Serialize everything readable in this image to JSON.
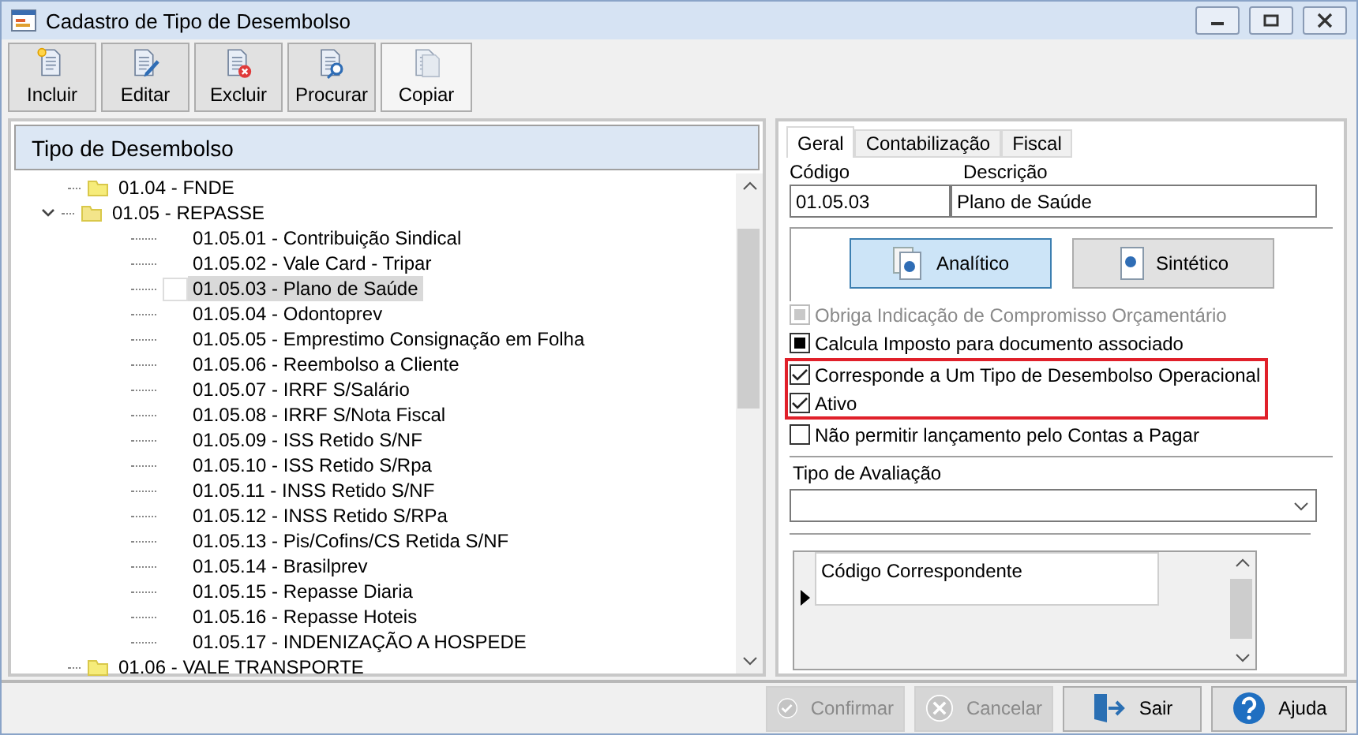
{
  "window": {
    "title": "Cadastro de Tipo de Desembolso"
  },
  "toolbar": [
    {
      "label": "Incluir",
      "kind": "new"
    },
    {
      "label": "Editar",
      "kind": "edit"
    },
    {
      "label": "Excluir",
      "kind": "delete"
    },
    {
      "label": "Procurar",
      "kind": "search"
    },
    {
      "label": "Copiar",
      "kind": "copy"
    }
  ],
  "tree": {
    "title": "Tipo de Desembolso",
    "items": [
      {
        "label": "01.04 - FNDE",
        "selected": false
      },
      {
        "label": "01.05 - REPASSE",
        "expanded": true,
        "selected": false,
        "children": [
          {
            "label": "01.05.01 - Contribuição Sindical",
            "selected": false
          },
          {
            "label": "01.05.02 - Vale Card - Tripar",
            "selected": false
          },
          {
            "label": "01.05.03 - Plano de Saúde",
            "selected": true
          },
          {
            "label": "01.05.04 - Odontoprev",
            "selected": false
          },
          {
            "label": "01.05.05 - Emprestimo Consignação em Folha",
            "selected": false
          },
          {
            "label": "01.05.06 - Reembolso a Cliente",
            "selected": false
          },
          {
            "label": "01.05.07 - IRRF S/Salário",
            "selected": false
          },
          {
            "label": "01.05.08 - IRRF S/Nota Fiscal",
            "selected": false
          },
          {
            "label": "01.05.09 - ISS Retido S/NF",
            "selected": false
          },
          {
            "label": "01.05.10 - ISS Retido S/Rpa",
            "selected": false
          },
          {
            "label": "01.05.11 - INSS Retido S/NF",
            "selected": false
          },
          {
            "label": "01.05.12 - INSS Retido S/RPa",
            "selected": false
          },
          {
            "label": "01.05.13 - Pis/Cofins/CS Retida S/NF",
            "selected": false
          },
          {
            "label": "01.05.14 - Brasilprev",
            "selected": false
          },
          {
            "label": "01.05.15 - Repasse Diaria",
            "selected": false
          },
          {
            "label": "01.05.16 - Repasse Hoteis",
            "selected": false
          },
          {
            "label": "01.05.17 - INDENIZAÇÃO A HOSPEDE",
            "selected": false
          }
        ]
      },
      {
        "label": "01.06 - VALE TRANSPORTE",
        "selected": false
      }
    ]
  },
  "tabs": [
    {
      "label": "Geral",
      "selected": true
    },
    {
      "label": "Contabilização",
      "selected": false
    },
    {
      "label": "Fiscal",
      "selected": false
    }
  ],
  "fields": {
    "code_label": "Código",
    "code_value": "01.05.03",
    "description_label": "Descrição",
    "description_value": "Plano de Saúde"
  },
  "type_buttons": [
    {
      "label": "Analítico",
      "selected": true,
      "kind": "stack"
    },
    {
      "label": "Sintético",
      "selected": false,
      "kind": "single"
    }
  ],
  "checkboxes": [
    {
      "label": "Obriga Indicação de Compromisso Orçamentário",
      "checked": false,
      "indeterminate": true,
      "disabled": true,
      "highlighted": false
    },
    {
      "label": "Calcula Imposto para documento associado",
      "checked": false,
      "indeterminate": true,
      "disabled": false,
      "highlighted": false
    },
    {
      "label": "Corresponde a Um Tipo de Desembolso Operacional",
      "checked": true,
      "disabled": false,
      "highlighted": true
    },
    {
      "label": "Ativo",
      "checked": true,
      "disabled": false,
      "highlighted": true
    },
    {
      "label": "Não permitir lançamento pelo Contas a Pagar",
      "checked": false,
      "indeterminate": false,
      "disabled": false,
      "highlighted": false
    }
  ],
  "evaluation": {
    "label": "Tipo de Avaliação"
  },
  "grid": {
    "columns": [
      "Código Correspondente"
    ]
  },
  "footer": [
    {
      "label": "Confirmar",
      "kind": "confirm",
      "disabled": true
    },
    {
      "label": "Cancelar",
      "kind": "cancel",
      "disabled": true
    },
    {
      "label": "Sair",
      "kind": "exit",
      "disabled": false
    },
    {
      "label": "Ajuda",
      "kind": "help",
      "disabled": false
    }
  ]
}
